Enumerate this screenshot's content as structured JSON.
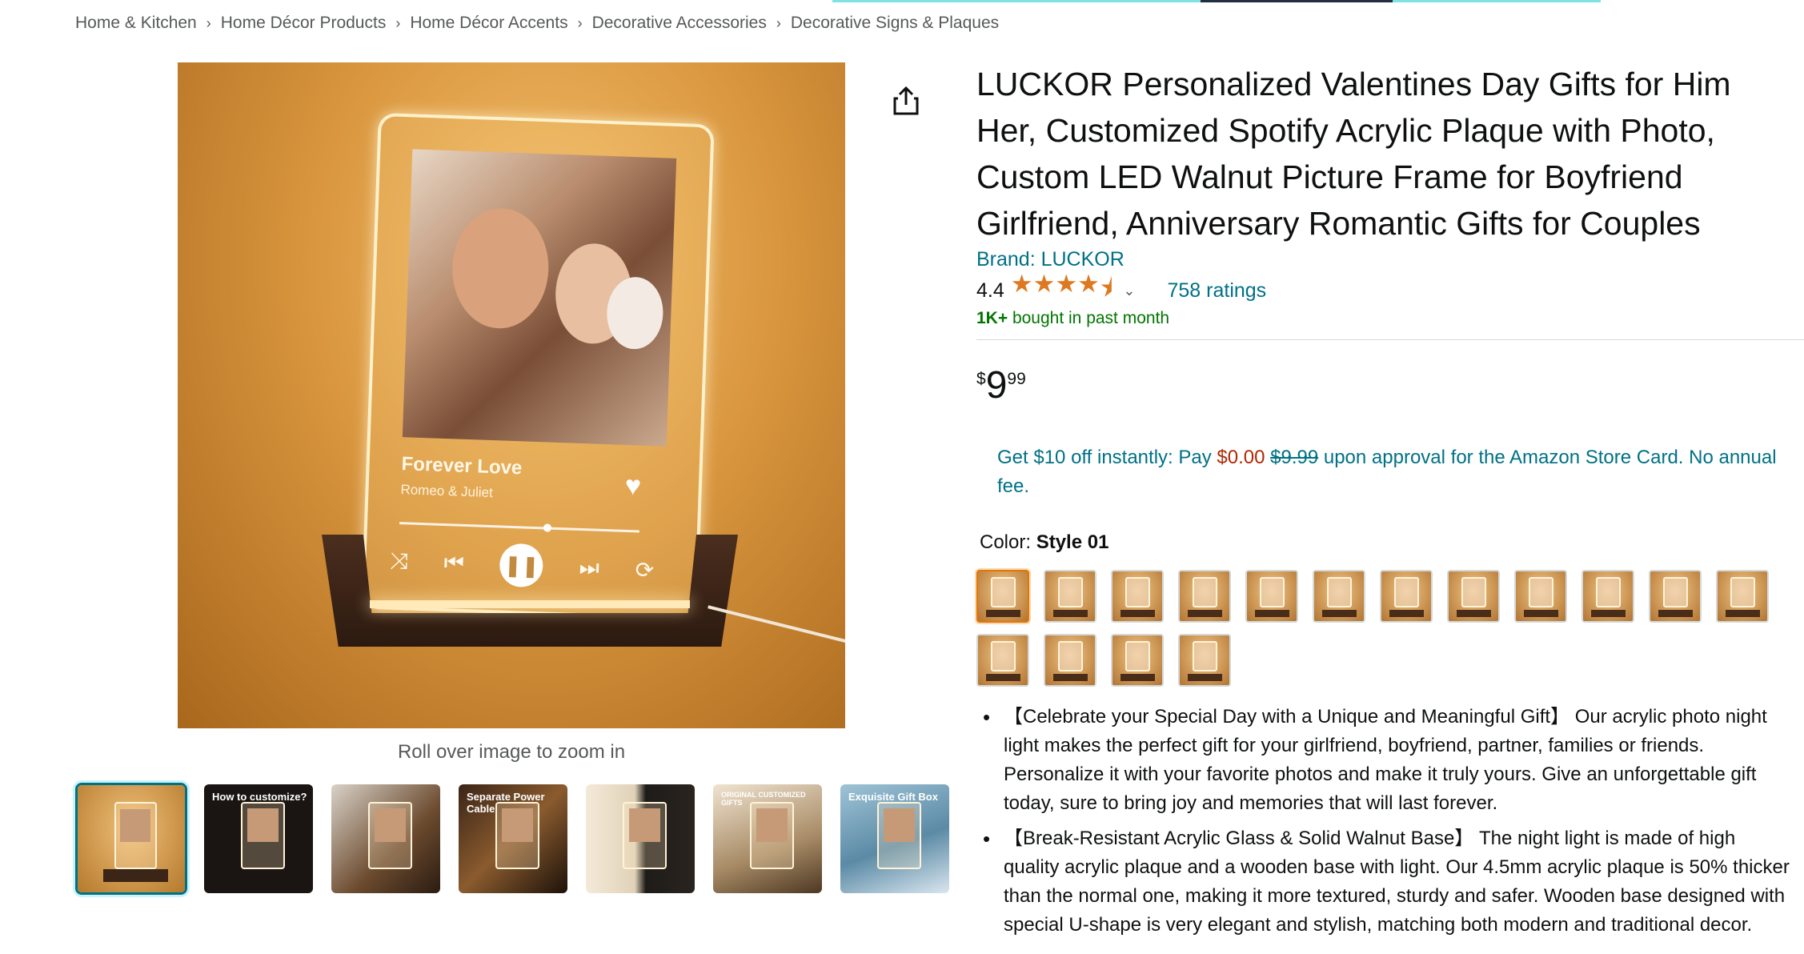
{
  "breadcrumb": [
    "Home & Kitchen",
    "Home Décor Products",
    "Home Décor Accents",
    "Decorative Accessories",
    "Decorative Signs & Plaques"
  ],
  "breadcrumb_separator": "›",
  "gallery": {
    "zoom_hint": "Roll over image to zoom in",
    "main_image": {
      "song_title": "Forever Love",
      "song_artist": "Romeo & Juliet"
    },
    "thumbnails": [
      {
        "label": ""
      },
      {
        "label": "How to customize?"
      },
      {
        "label": ""
      },
      {
        "label": "Separate Power Cable"
      },
      {
        "label": ""
      },
      {
        "label": "ORIGINAL CUSTOMIZED GIFTS"
      },
      {
        "label": "Exquisite Gift Box"
      }
    ]
  },
  "product": {
    "title": "LUCKOR Personalized Valentines Day Gifts for Him Her, Customized Spotify Acrylic Plaque with Photo, Custom LED Walnut Picture Frame for Boyfriend Girlfriend, Anniversary Romantic Gifts for Couples",
    "brand": "Brand: LUCKOR",
    "rating": "4.4",
    "rating_value": 4.4,
    "ratings_count": "758 ratings",
    "bought_strong": "1K+",
    "bought_rest": " bought in past month",
    "price": {
      "symbol": "$",
      "whole": "9",
      "fraction": "99"
    },
    "card_offer": {
      "part1": "Get $10 off instantly: Pay ",
      "pay_amount": "$0.00",
      "space": " ",
      "original": "$9.99",
      "part2": " upon approval for the Amazon Store Card. No annual fee."
    },
    "color": {
      "label": "Color: ",
      "selected": "Style 01",
      "swatch_count": 16
    },
    "bullets": [
      "【Celebrate your Special Day with a Unique and Meaningful Gift】 Our acrylic photo night light makes the perfect gift for your girlfriend, boyfriend, partner, families or friends. Personalize it with your favorite photos and make it truly yours. Give an unforgettable gift today, sure to bring joy and memories that will last forever.",
      "【Break-Resistant Acrylic Glass & Solid Walnut Base】 The night light is made of high quality acrylic plaque and a wooden base with light. Our 4.5mm acrylic plaque is 50% thicker than the normal one, making it more textured, sturdy and safer. Wooden base designed with special U-shape is very elegant and stylish, matching both modern and traditional decor."
    ]
  },
  "colors": {
    "link": "#007185",
    "star": "#de7921",
    "price_red": "#b12704",
    "bought_green": "#007600",
    "selected_thumb": "#007185",
    "selected_swatch": "#e77600"
  },
  "icons": {
    "share": "share-icon",
    "star": "star-icon",
    "chevron": "chevron-down-icon",
    "heart": "heart-icon",
    "pause": "pause-icon"
  }
}
